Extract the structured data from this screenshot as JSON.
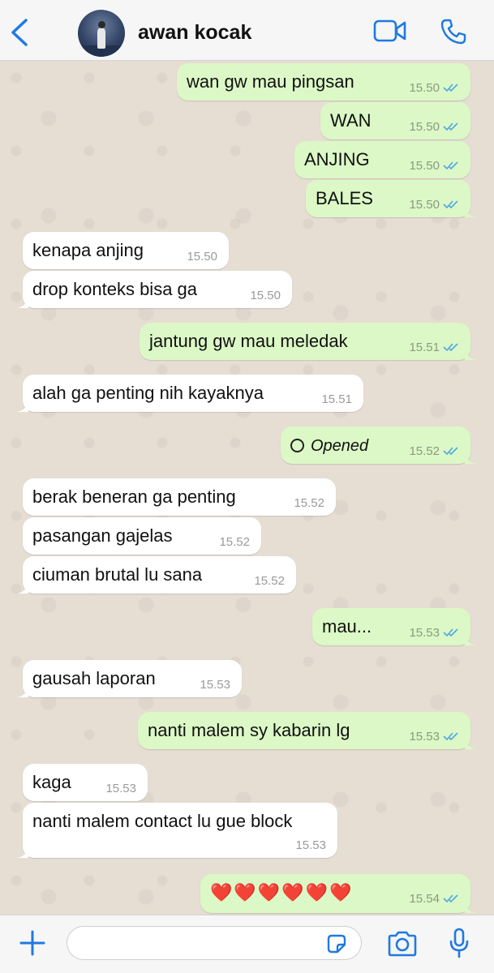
{
  "header": {
    "contact_name": "awan kocak",
    "icons": [
      "chevron-left-icon",
      "video-call-icon",
      "phone-icon"
    ]
  },
  "messages": [
    {
      "direction": "out",
      "text": "wan gw mau pingsan",
      "time": "15.50",
      "status": "read"
    },
    {
      "direction": "out",
      "text": "WAN",
      "time": "15.50",
      "status": "read"
    },
    {
      "direction": "out",
      "text": "ANJING",
      "time": "15.50",
      "status": "read"
    },
    {
      "direction": "out",
      "text": "BALES",
      "time": "15.50",
      "status": "read"
    },
    {
      "direction": "in",
      "text": "kenapa anjing",
      "time": "15.50"
    },
    {
      "direction": "in",
      "text": "drop konteks bisa ga",
      "time": "15.50"
    },
    {
      "direction": "out",
      "text": "jantung gw mau meledak",
      "time": "15.51",
      "status": "read"
    },
    {
      "direction": "in",
      "text": "alah ga penting nih kayaknya",
      "time": "15.51"
    },
    {
      "direction": "out",
      "text": "Opened",
      "time": "15.52",
      "status": "read",
      "kind": "view-once"
    },
    {
      "direction": "in",
      "text": "berak beneran ga penting",
      "time": "15.52"
    },
    {
      "direction": "in",
      "text": "pasangan gajelas",
      "time": "15.52"
    },
    {
      "direction": "in",
      "text": "ciuman brutal lu sana",
      "time": "15.52"
    },
    {
      "direction": "out",
      "text": "mau...",
      "time": "15.53",
      "status": "read"
    },
    {
      "direction": "in",
      "text": "gausah laporan",
      "time": "15.53"
    },
    {
      "direction": "out",
      "text": "nanti malem sy kabarin lg",
      "time": "15.53",
      "status": "read"
    },
    {
      "direction": "in",
      "text": "kaga",
      "time": "15.53"
    },
    {
      "direction": "in",
      "text": "nanti malem contact lu gue block",
      "time": "15.53"
    },
    {
      "direction": "out",
      "text": "❤️❤️❤️❤️❤️❤️",
      "time": "15.54",
      "status": "read"
    }
  ],
  "composer": {
    "input_value": "",
    "icons": [
      "plus-icon",
      "sticker-icon",
      "camera-icon",
      "microphone-icon"
    ]
  },
  "colors": {
    "accent": "#1f7ae0",
    "outgoing_bubble": "#dcf8c6",
    "incoming_bubble": "#ffffff",
    "chat_background": "#e6ddd3",
    "read_ticks": "#4fa8e0"
  }
}
